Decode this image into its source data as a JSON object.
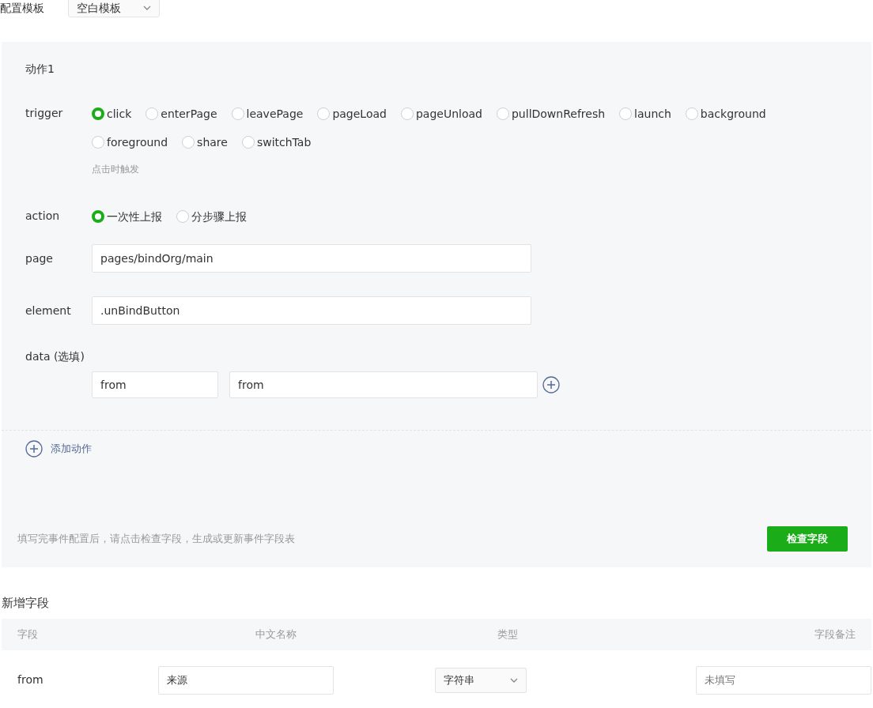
{
  "template": {
    "label": "配置模板",
    "value": "空白模板"
  },
  "action_block": {
    "title": "动作1",
    "trigger": {
      "label": "trigger",
      "options": [
        {
          "label": "click",
          "selected": true
        },
        {
          "label": "enterPage",
          "selected": false
        },
        {
          "label": "leavePage",
          "selected": false
        },
        {
          "label": "pageLoad",
          "selected": false
        },
        {
          "label": "pageUnload",
          "selected": false
        },
        {
          "label": "pullDownRefresh",
          "selected": false
        },
        {
          "label": "launch",
          "selected": false
        },
        {
          "label": "background",
          "selected": false
        },
        {
          "label": "foreground",
          "selected": false
        },
        {
          "label": "share",
          "selected": false
        },
        {
          "label": "switchTab",
          "selected": false
        }
      ],
      "hint": "点击时触发"
    },
    "action": {
      "label": "action",
      "options": [
        {
          "label": "一次性上报",
          "selected": true
        },
        {
          "label": "分步骤上报",
          "selected": false
        }
      ]
    },
    "page": {
      "label": "page",
      "value": "pages/bindOrg/main"
    },
    "element": {
      "label": "element",
      "value": ".unBindButton"
    },
    "data": {
      "label": "data (选填)",
      "key": "from",
      "value": "from"
    }
  },
  "add_action": "添加动作",
  "footer": {
    "text": "填写完事件配置后，请点击检查字段，生成或更新事件字段表",
    "button": "检查字段"
  },
  "new_fields": {
    "title": "新增字段",
    "columns": [
      "字段",
      "中文名称",
      "类型",
      "字段备注"
    ],
    "rows": [
      {
        "field": "from",
        "name": "来源",
        "type": "字符串",
        "note_placeholder": "未填写"
      }
    ]
  }
}
